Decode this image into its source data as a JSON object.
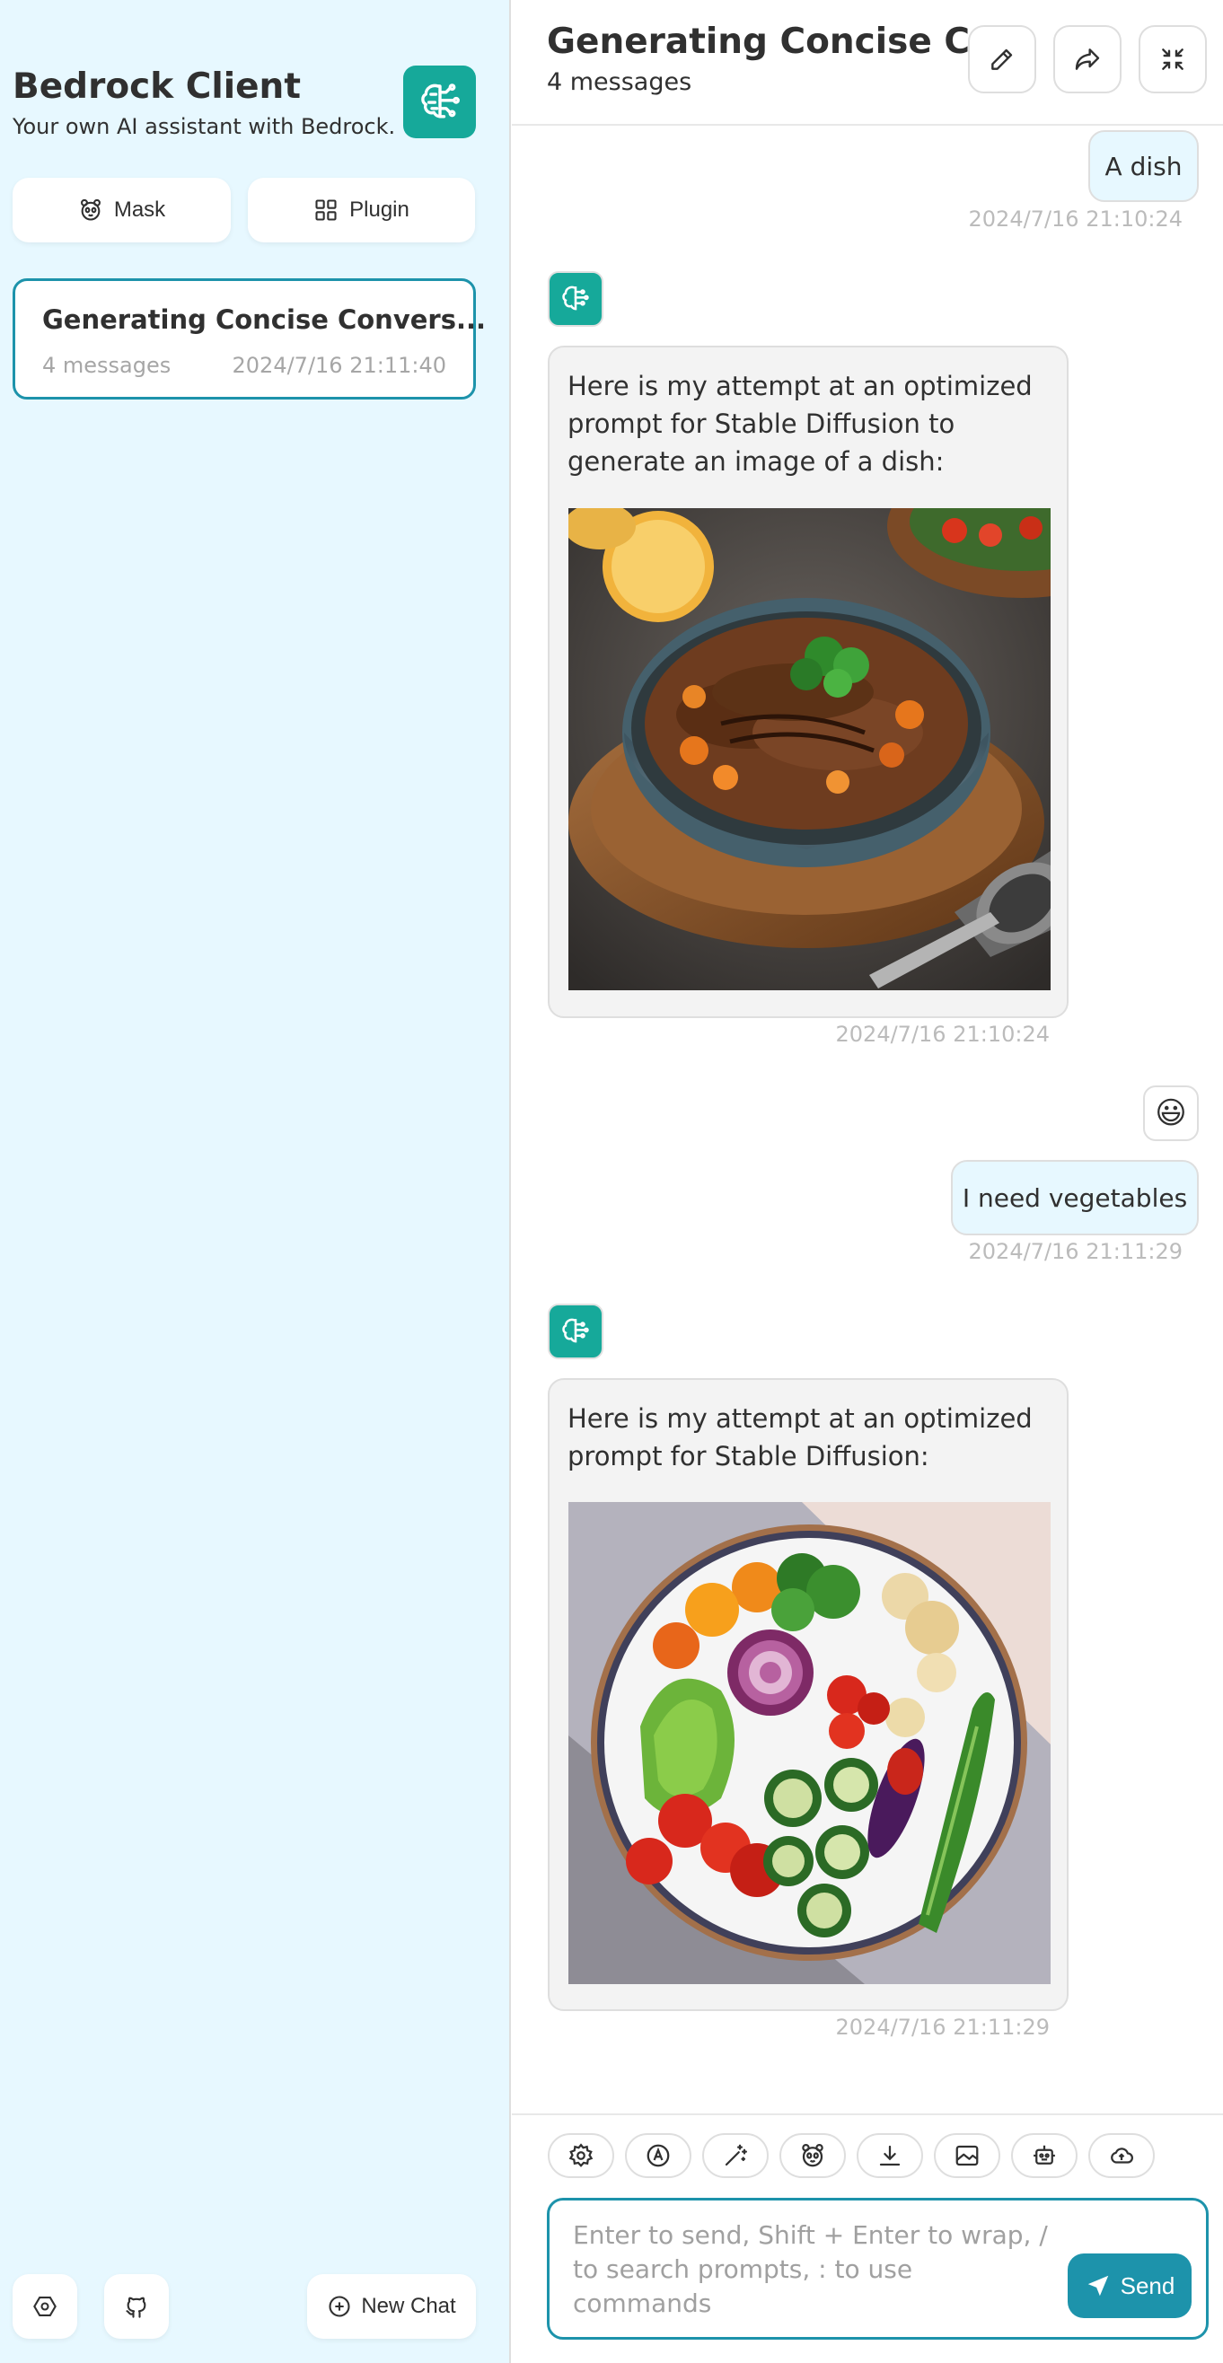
{
  "sidebar": {
    "title": "Bedrock Client",
    "subtitle": "Your own AI assistant with Bedrock.",
    "mask_label": "Mask",
    "plugin_label": "Plugin",
    "chat_item": {
      "title": "Generating Concise Convers...",
      "count": "4 messages",
      "date": "2024/7/16 21:11:40"
    },
    "new_chat_label": "New Chat"
  },
  "header": {
    "title": "Generating Concise C...",
    "subtitle": "4 messages"
  },
  "messages": [
    {
      "role": "user",
      "text": "A dish",
      "time": "2024/7/16 21:10:24"
    },
    {
      "role": "assistant",
      "text": "Here is my attempt at an optimized prompt for Stable Diffusion to generate an image of a dish:",
      "time": "2024/7/16 21:10:24",
      "image": "bowl-of-grilled-chicken-and-vegetables"
    },
    {
      "role": "user",
      "avatar": "😃",
      "text": "I need vegetables",
      "time": "2024/7/16 21:11:29"
    },
    {
      "role": "assistant",
      "text": "Here is my attempt at an optimized prompt for Stable Diffusion:",
      "time": "2024/7/16 21:11:29",
      "image": "plate-of-vegetables-illustration"
    }
  ],
  "input": {
    "placeholder": "Enter to send, Shift + Enter to wrap, / to search prompts, : to use commands",
    "send_label": "Send"
  },
  "colors": {
    "sidebar_bg": "#e7f8ff",
    "accent": "#1d93ab",
    "logo_bg": "#16a99a",
    "user_bubble": "#e7f8ff",
    "bot_bubble": "#f3f3f3"
  }
}
